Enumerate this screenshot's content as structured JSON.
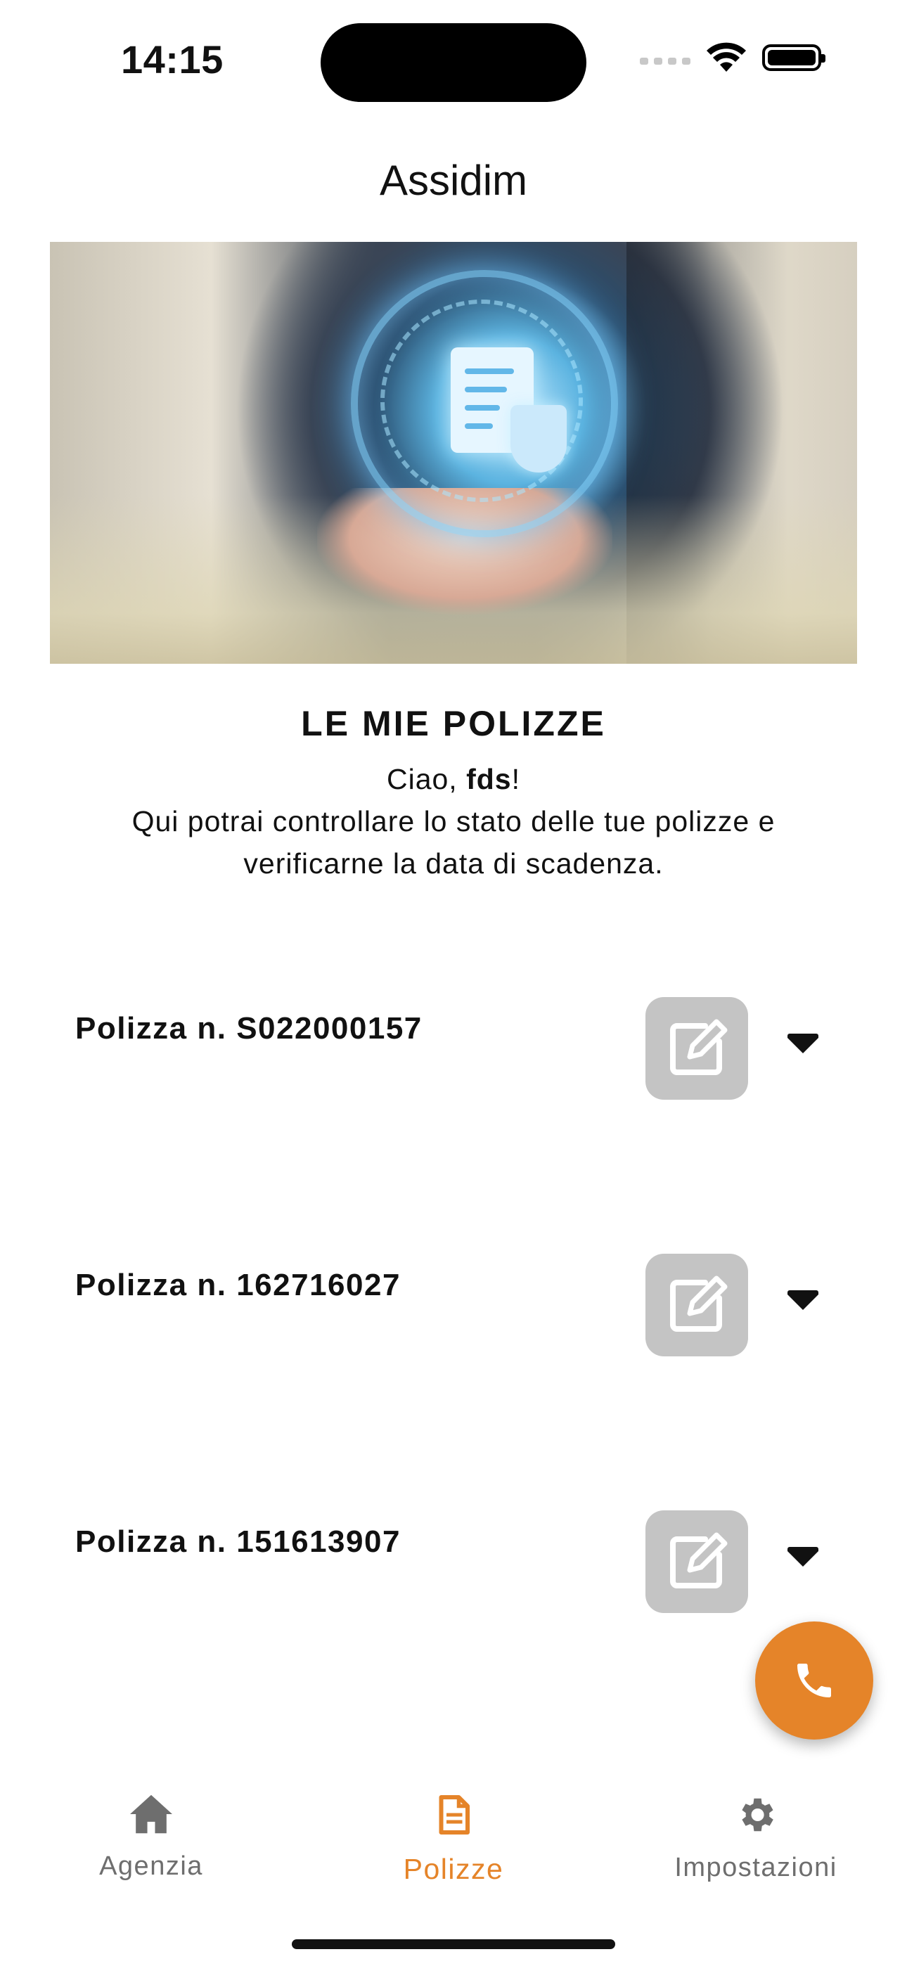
{
  "status_bar": {
    "time": "14:15"
  },
  "header": {
    "title": "Assidim"
  },
  "intro": {
    "heading": "LE MIE POLIZZE",
    "greeting_prefix": "Ciao, ",
    "user_name": "fds",
    "greeting_suffix": "!",
    "description": "Qui potrai controllare lo stato delle tue polizze e verificarne la data di scadenza."
  },
  "policies": [
    {
      "label": "Polizza n. S022000157"
    },
    {
      "label": "Polizza n. 162716027"
    },
    {
      "label": "Polizza n. 151613907"
    }
  ],
  "fab": {
    "icon": "phone-icon"
  },
  "bottom_nav": {
    "active": "Polizze",
    "items": [
      {
        "label": "Agenzia",
        "icon": "home-icon"
      },
      {
        "label": "Polizze",
        "icon": "document-icon"
      },
      {
        "label": "Impostazioni",
        "icon": "gear-icon"
      }
    ]
  },
  "colors": {
    "accent": "#e58429",
    "edit_button": "#c4c4c4",
    "inactive_nav": "#6e6e6e"
  }
}
